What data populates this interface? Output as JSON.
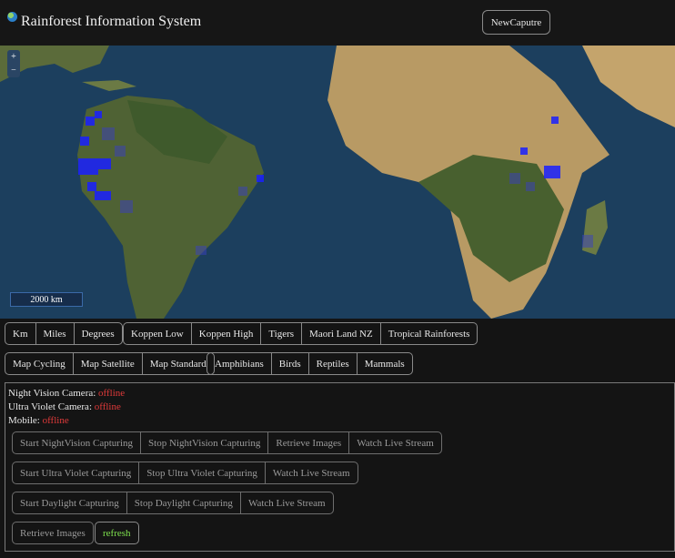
{
  "header": {
    "title": "Rainforest Information System",
    "new_capture_label": "NewCaputre"
  },
  "map": {
    "zoom_in": "+",
    "zoom_out": "−",
    "scale_label": "2000 km",
    "ocean_color": "#1c3f5e",
    "land_color": "#5b6b3a",
    "desert_color": "#b89a64",
    "heat_color": "#1a20ff"
  },
  "units_group": [
    "Km",
    "Miles",
    "Degrees"
  ],
  "layers_group": [
    "Koppen Low",
    "Koppen High",
    "Tigers",
    "Maori Land NZ",
    "Tropical Rainforests"
  ],
  "map_style_group": [
    "Map Cycling",
    "Map Satellite",
    "Map Standard"
  ],
  "species_group": [
    "Amphibians",
    "Birds",
    "Reptiles",
    "Mammals"
  ],
  "devices": {
    "night_label": "Night Vision Camera:",
    "night_status": "offline",
    "uv_label": "Ultra Violet Camera:",
    "uv_status": "offline",
    "mobile_label": "Mobile:",
    "mobile_status": "offline"
  },
  "night_controls": [
    "Start NightVision Capturing",
    "Stop NightVision Capturing",
    "Retrieve Images",
    "Watch Live Stream"
  ],
  "uv_controls": [
    "Start Ultra Violet Capturing",
    "Stop Ultra Violet Capturing",
    "Watch Live Stream"
  ],
  "day_controls": [
    "Start Daylight Capturing",
    "Stop Daylight Capturing",
    "Watch Live Stream"
  ],
  "bottom": {
    "retrieve_label": "Retrieve Images",
    "refresh_label": "refresh"
  }
}
